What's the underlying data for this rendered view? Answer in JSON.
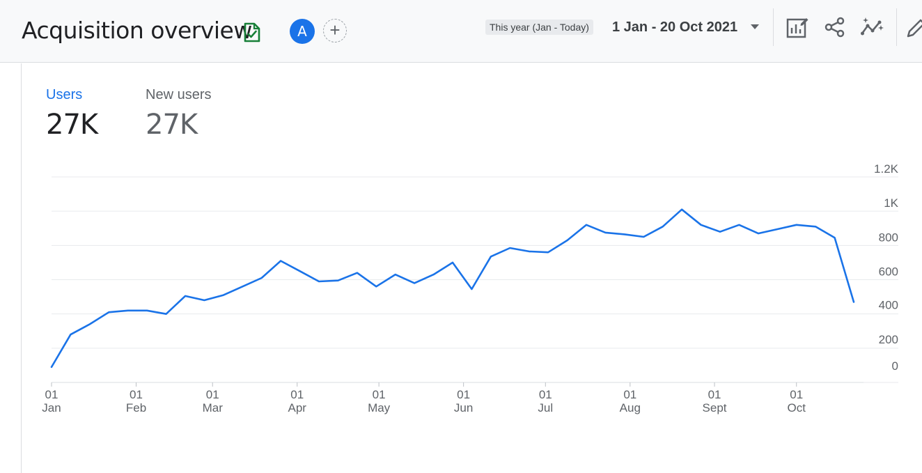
{
  "header": {
    "title": "Acquisition overview",
    "avatar_letter": "A",
    "add_user_symbol": "+",
    "range_chip": "This year (Jan - Today)",
    "date_range": "1 Jan - 20 Oct 2021",
    "icons": [
      "report-check-icon",
      "chevron-down-icon",
      "customize-report-icon",
      "share-icon",
      "insights-icon",
      "edit-icon"
    ],
    "accent_color": "#1a73e8",
    "report_icon_color": "#188038"
  },
  "metrics": [
    {
      "label": "Users",
      "value": "27K",
      "active": true
    },
    {
      "label": "New users",
      "value": "27K",
      "active": false
    }
  ],
  "chart_data": {
    "type": "line",
    "series": [
      {
        "color": "#1a73e8",
        "values": [
          90,
          280,
          340,
          410,
          420,
          420,
          400,
          505,
          480,
          510,
          560,
          610,
          710,
          650,
          590,
          595,
          640,
          560,
          630,
          580,
          630,
          700,
          545,
          735,
          785,
          765,
          760,
          830,
          920,
          875,
          865,
          850,
          910,
          1010,
          920,
          880,
          920,
          870,
          895,
          920,
          910,
          845,
          470
        ]
      }
    ],
    "x_tick_labels": [
      {
        "day": "01",
        "month": "Jan",
        "index": 0
      },
      {
        "day": "01",
        "month": "Feb",
        "index": 4.43
      },
      {
        "day": "01",
        "month": "Mar",
        "index": 8.43
      },
      {
        "day": "01",
        "month": "Apr",
        "index": 12.86
      },
      {
        "day": "01",
        "month": "May",
        "index": 17.14
      },
      {
        "day": "01",
        "month": "Jun",
        "index": 21.57
      },
      {
        "day": "01",
        "month": "Jul",
        "index": 25.86
      },
      {
        "day": "01",
        "month": "Aug",
        "index": 30.29
      },
      {
        "day": "01",
        "month": "Sept",
        "index": 34.71
      },
      {
        "day": "01",
        "month": "Oct",
        "index": 39
      }
    ],
    "y_tick_labels": [
      "0",
      "200",
      "400",
      "600",
      "800",
      "1K",
      "1.2K"
    ],
    "y_ticks": [
      0,
      200,
      400,
      600,
      800,
      1000,
      1200
    ],
    "ylim": [
      0,
      1200
    ],
    "grid": true
  }
}
